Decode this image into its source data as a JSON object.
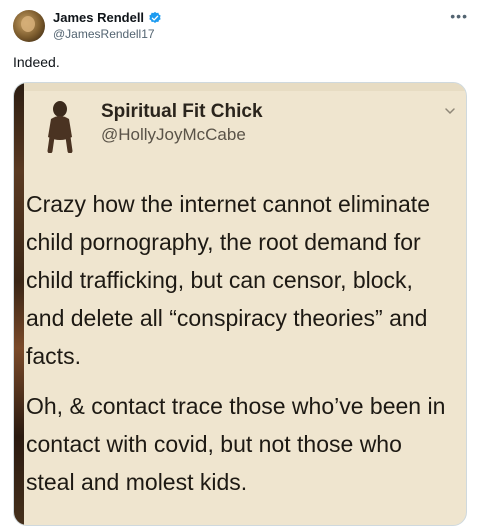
{
  "tweet": {
    "author": {
      "display_name": "James Rendell",
      "handle": "@JamesRendell17",
      "verified": true
    },
    "text": "Indeed.",
    "more_icon": "more-horizontal-icon"
  },
  "embedded_image": {
    "author_name": "Spiritual Fit Chick",
    "author_handle": "@HollyJoyMcCabe",
    "paragraph_1": "Crazy how the internet cannot eliminate child pornography, the root demand for child trafficking, but can censor, block, and delete all “conspiracy theories” and facts.",
    "paragraph_2": "Oh, & contact trace those who’ve been in contact with covid, but not those who steal and molest kids."
  },
  "colors": {
    "verified_blue": "#1d9bf0",
    "text_secondary": "#536471",
    "image_bg": "#efe5cf"
  }
}
